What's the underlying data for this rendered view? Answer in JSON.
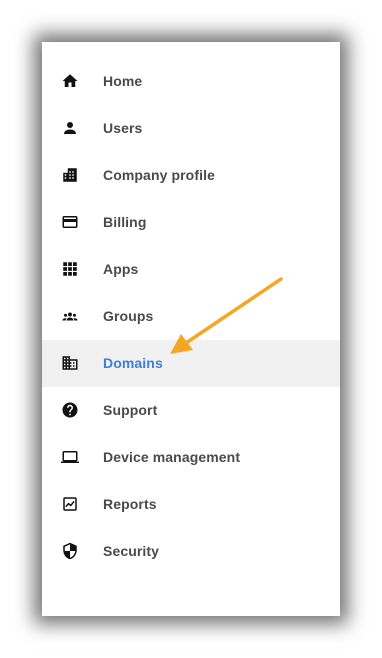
{
  "sidebar": {
    "items": [
      {
        "label": "Home",
        "icon": "home-icon",
        "active": false
      },
      {
        "label": "Users",
        "icon": "user-icon",
        "active": false
      },
      {
        "label": "Company profile",
        "icon": "building-icon",
        "active": false
      },
      {
        "label": "Billing",
        "icon": "credit-card-icon",
        "active": false
      },
      {
        "label": "Apps",
        "icon": "apps-grid-icon",
        "active": false
      },
      {
        "label": "Groups",
        "icon": "groups-icon",
        "active": false
      },
      {
        "label": "Domains",
        "icon": "domain-icon",
        "active": true
      },
      {
        "label": "Support",
        "icon": "help-circle-icon",
        "active": false
      },
      {
        "label": "Device management",
        "icon": "laptop-icon",
        "active": false
      },
      {
        "label": "Reports",
        "icon": "chart-icon",
        "active": false
      },
      {
        "label": "Security",
        "icon": "shield-icon",
        "active": false
      }
    ]
  },
  "colors": {
    "active_text": "#3b7de0",
    "active_bg": "#f1f1f1",
    "text": "#4a4a4a",
    "annotation_arrow": "#f5a623"
  },
  "annotation": {
    "type": "arrow",
    "points_to": "Domains"
  }
}
